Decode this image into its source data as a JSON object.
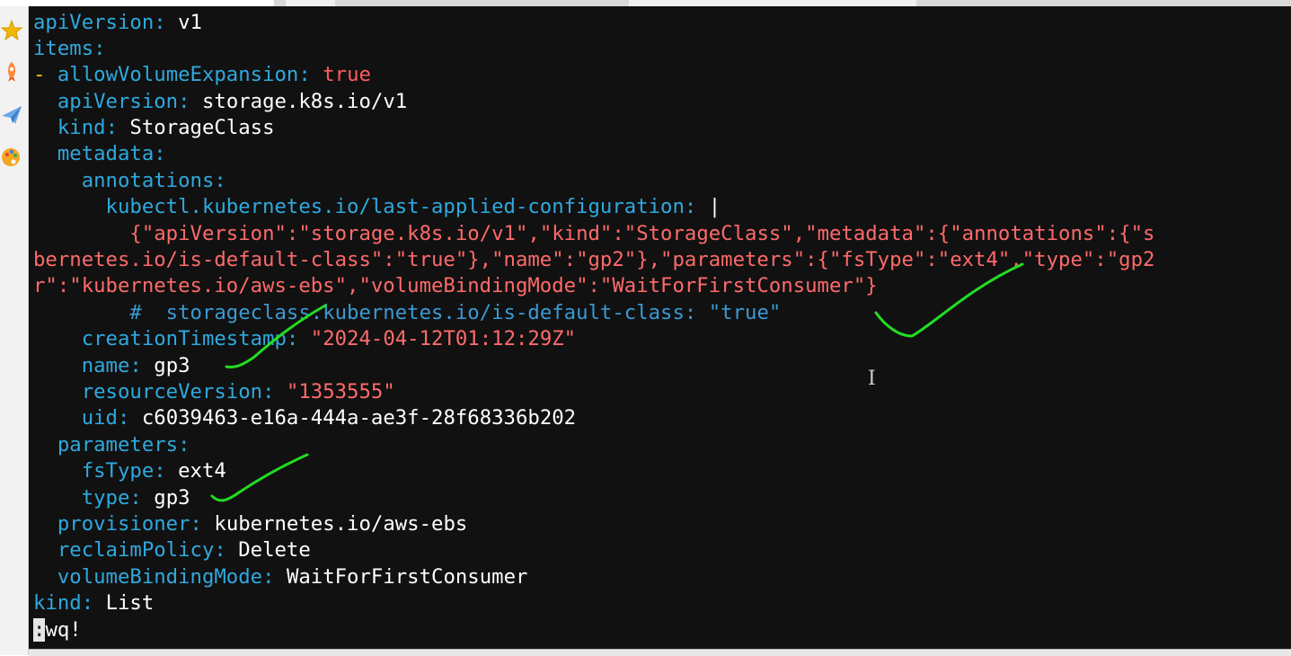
{
  "editor": {
    "lines": {
      "l1": {
        "key": "apiVersion",
        "colon": ":",
        "value": " v1"
      },
      "l2": {
        "key": "items",
        "colon": ":"
      },
      "l3": {
        "dash": "-",
        "key": "allowVolumeExpansion",
        "colon": ":",
        "value": " true"
      },
      "l4": {
        "key": "apiVersion",
        "colon": ":",
        "value": " storage.k8s.io/v1"
      },
      "l5": {
        "key": "kind",
        "colon": ":",
        "value": " StorageClass"
      },
      "l6": {
        "key": "metadata",
        "colon": ":"
      },
      "l7": {
        "key": "annotations",
        "colon": ":"
      },
      "l8": {
        "key": "kubectl.kubernetes.io/last-applied-configuration",
        "colon": ":",
        "value": " |"
      },
      "l9": {
        "text": "{\"apiVersion\":\"storage.k8s.io/v1\",\"kind\":\"StorageClass\",\"metadata\":{\"annotations\":{\"s"
      },
      "l10": {
        "text": "bernetes.io/is-default-class\":\"true\"},\"name\":\"gp2\"},\"parameters\":{\"fsType\":\"ext4\",\"type\":\"gp2"
      },
      "l11": {
        "text": "r\":\"kubernetes.io/aws-ebs\",\"volumeBindingMode\":\"WaitForFirstConsumer\"}"
      },
      "l12": {
        "text": "#  storageclass.kubernetes.io/is-default-class: \"true\""
      },
      "l13": {
        "key": "creationTimestamp",
        "colon": ":",
        "value": " \"2024-04-12T01:12:29Z\""
      },
      "l14": {
        "key": "name",
        "colon": ":",
        "value": " gp3"
      },
      "l15": {
        "key": "resourceVersion",
        "colon": ":",
        "value": " \"1353555\""
      },
      "l16": {
        "key": "uid",
        "colon": ":",
        "value": " c6039463-e16a-444a-ae3f-28f68336b202"
      },
      "l17": {
        "key": "parameters",
        "colon": ":"
      },
      "l18": {
        "key": "fsType",
        "colon": ":",
        "value": " ext4"
      },
      "l19": {
        "key": "type",
        "colon": ":",
        "value": " gp3"
      },
      "l20": {
        "key": "provisioner",
        "colon": ":",
        "value": " kubernetes.io/aws-ebs"
      },
      "l21": {
        "key": "reclaimPolicy",
        "colon": ":",
        "value": " Delete"
      },
      "l22": {
        "key": "volumeBindingMode",
        "colon": ":",
        "value": " WaitForFirstConsumer"
      },
      "l23": {
        "key": "kind",
        "colon": ":",
        "value": " List"
      }
    },
    "command": {
      "prefix": ":",
      "rest": "wq!"
    }
  },
  "sidebar": {
    "icons": [
      "star-icon",
      "rocket-icon",
      "paper-plane-icon",
      "palette-icon"
    ]
  },
  "colors": {
    "background": "#111111",
    "key": "#2fa9de",
    "value": "#ffffff",
    "boolean": "#ff5c5c",
    "string": "#ff6a6a",
    "comment": "#3a9ad4",
    "annotation_mark": "#22dd22"
  }
}
